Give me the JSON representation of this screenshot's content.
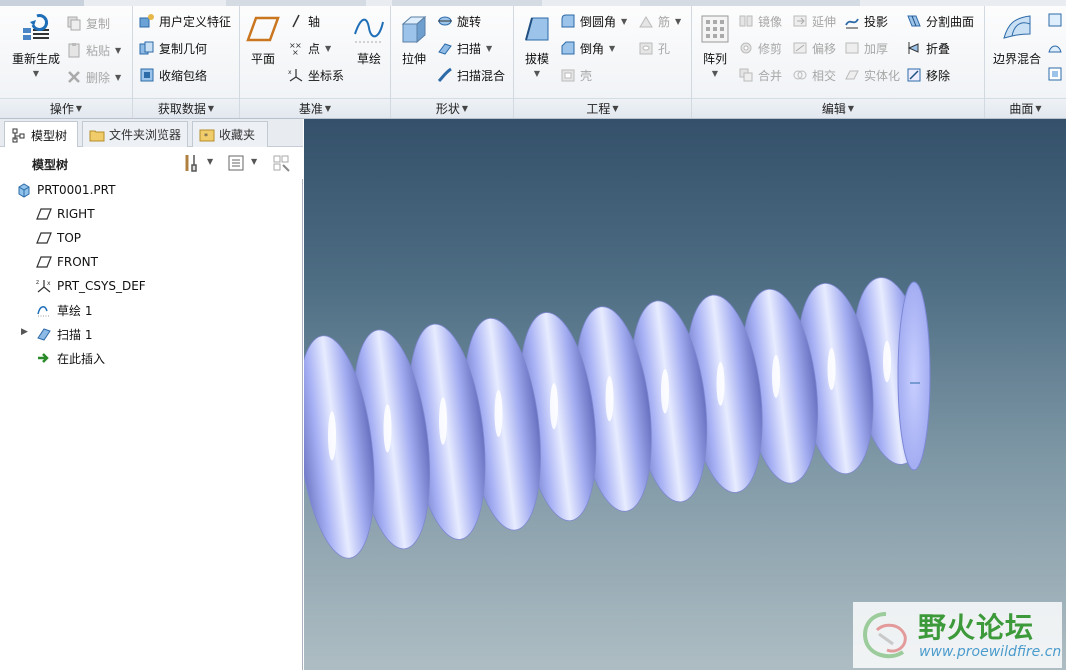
{
  "ribbon": {
    "groups": {
      "operations": {
        "label": "操作",
        "regenerate": "重新生成",
        "copy": "复制",
        "paste": "粘贴",
        "delete": "删除"
      },
      "get_data": {
        "label": "获取数据",
        "udf": "用户定义特征",
        "copy_geometry": "复制几何",
        "shrinkwrap": "收缩包络"
      },
      "datum": {
        "label": "基准",
        "plane": "平面",
        "axis": "轴",
        "point": "点",
        "csys": "坐标系",
        "sketch": "草绘"
      },
      "shapes": {
        "label": "形状",
        "extrude": "拉伸",
        "revolve": "旋转",
        "sweep": "扫描",
        "swept_blend": "扫描混合"
      },
      "engineering": {
        "label": "工程",
        "draft": "拔模",
        "round": "倒圆角",
        "chamfer": "倒角",
        "shell": "壳",
        "rib": "筋",
        "hole": "孔"
      },
      "editing": {
        "label": "编辑",
        "pattern": "阵列",
        "mirror": "镜像",
        "trim": "修剪",
        "merge": "合并",
        "extend": "延伸",
        "offset": "偏移",
        "intersect": "相交",
        "project": "投影",
        "thicken": "加厚",
        "solidify": "实体化",
        "split_surface": "分割曲面",
        "fold": "折叠",
        "remove": "移除"
      },
      "surfaces": {
        "label": "曲面",
        "boundary_blend": "边界混合"
      }
    }
  },
  "panel": {
    "tabs": [
      {
        "label": "模型树",
        "icon": "model-tree-icon"
      },
      {
        "label": "文件夹浏览器",
        "icon": "folder-browser-icon"
      },
      {
        "label": "收藏夹",
        "icon": "favorites-icon"
      }
    ],
    "title": "模型树",
    "tree": [
      {
        "label": "PRT0001.PRT",
        "icon": "part-icon"
      },
      {
        "label": "RIGHT",
        "icon": "datum-plane-icon"
      },
      {
        "label": "TOP",
        "icon": "datum-plane-icon"
      },
      {
        "label": "FRONT",
        "icon": "datum-plane-icon"
      },
      {
        "label": "PRT_CSYS_DEF",
        "icon": "csys-icon"
      },
      {
        "label": "草绘 1",
        "icon": "sketch-icon"
      },
      {
        "label": "扫描 1",
        "icon": "sweep-icon"
      },
      {
        "label": "在此插入",
        "icon": "insert-here-icon"
      }
    ]
  },
  "viewport": {
    "model": "coiled-spring-tube",
    "watermark_title": "野火论坛",
    "watermark_url": "www.proewildfire.cn"
  },
  "colors": {
    "model_surface": "#9aa6ee",
    "background_top": "#34506a",
    "background_bottom": "#aebdc3",
    "watermark_green": "#3d9a3a"
  }
}
